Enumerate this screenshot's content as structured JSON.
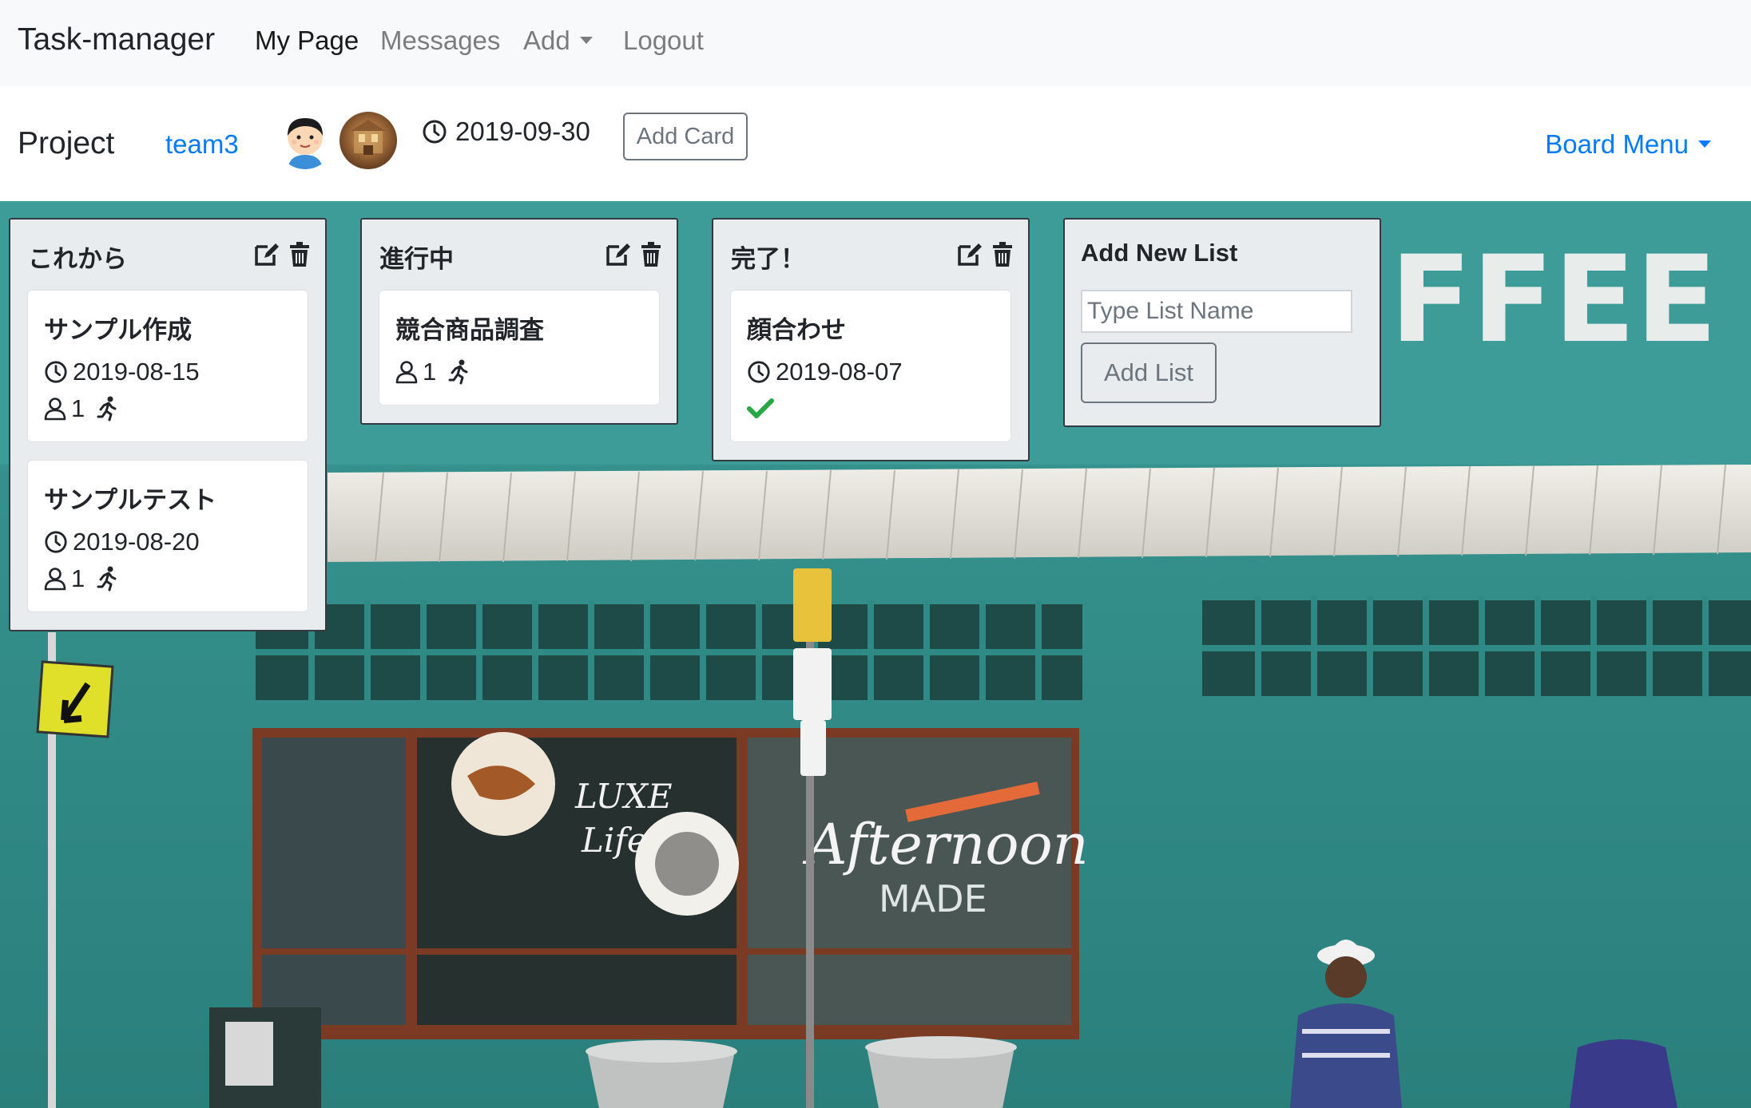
{
  "navbar": {
    "brand": "Task-manager",
    "links": [
      {
        "label": "My Page",
        "active": true
      },
      {
        "label": "Messages",
        "active": false
      },
      {
        "label": "Add",
        "dropdown": true
      },
      {
        "label": "Logout",
        "active": false
      }
    ]
  },
  "project": {
    "title": "Project",
    "team": "team3",
    "deadline": "2019-09-30",
    "add_card_label": "Add Card",
    "board_menu_label": "Board Menu"
  },
  "lists": [
    {
      "title": "これから",
      "cards": [
        {
          "title": "サンプル作成",
          "due": "2019-08-15",
          "members": "1",
          "status_icon": "running-icon"
        },
        {
          "title": "サンプルテスト",
          "due": "2019-08-20",
          "members": "1",
          "status_icon": "running-icon"
        }
      ]
    },
    {
      "title": "進行中",
      "cards": [
        {
          "title": "競合商品調査",
          "members": "1",
          "status_icon": "running-icon"
        }
      ]
    },
    {
      "title": "完了！",
      "cards": [
        {
          "title": "顔合わせ",
          "due": "2019-08-07",
          "status_icon": "check-icon"
        }
      ]
    }
  ],
  "new_list": {
    "title": "Add New List",
    "placeholder": "Type List Name",
    "button_label": "Add List"
  },
  "colors": {
    "link": "#007bff",
    "navbar_bg": "#f8f9fa",
    "list_bg": "#e9ecef",
    "done_check": "#28a745",
    "wall_teal": "#2f8a86"
  },
  "icons": [
    "clock-icon",
    "user-icon",
    "running-icon",
    "edit-icon",
    "trash-icon",
    "check-icon",
    "caret-down-icon"
  ]
}
